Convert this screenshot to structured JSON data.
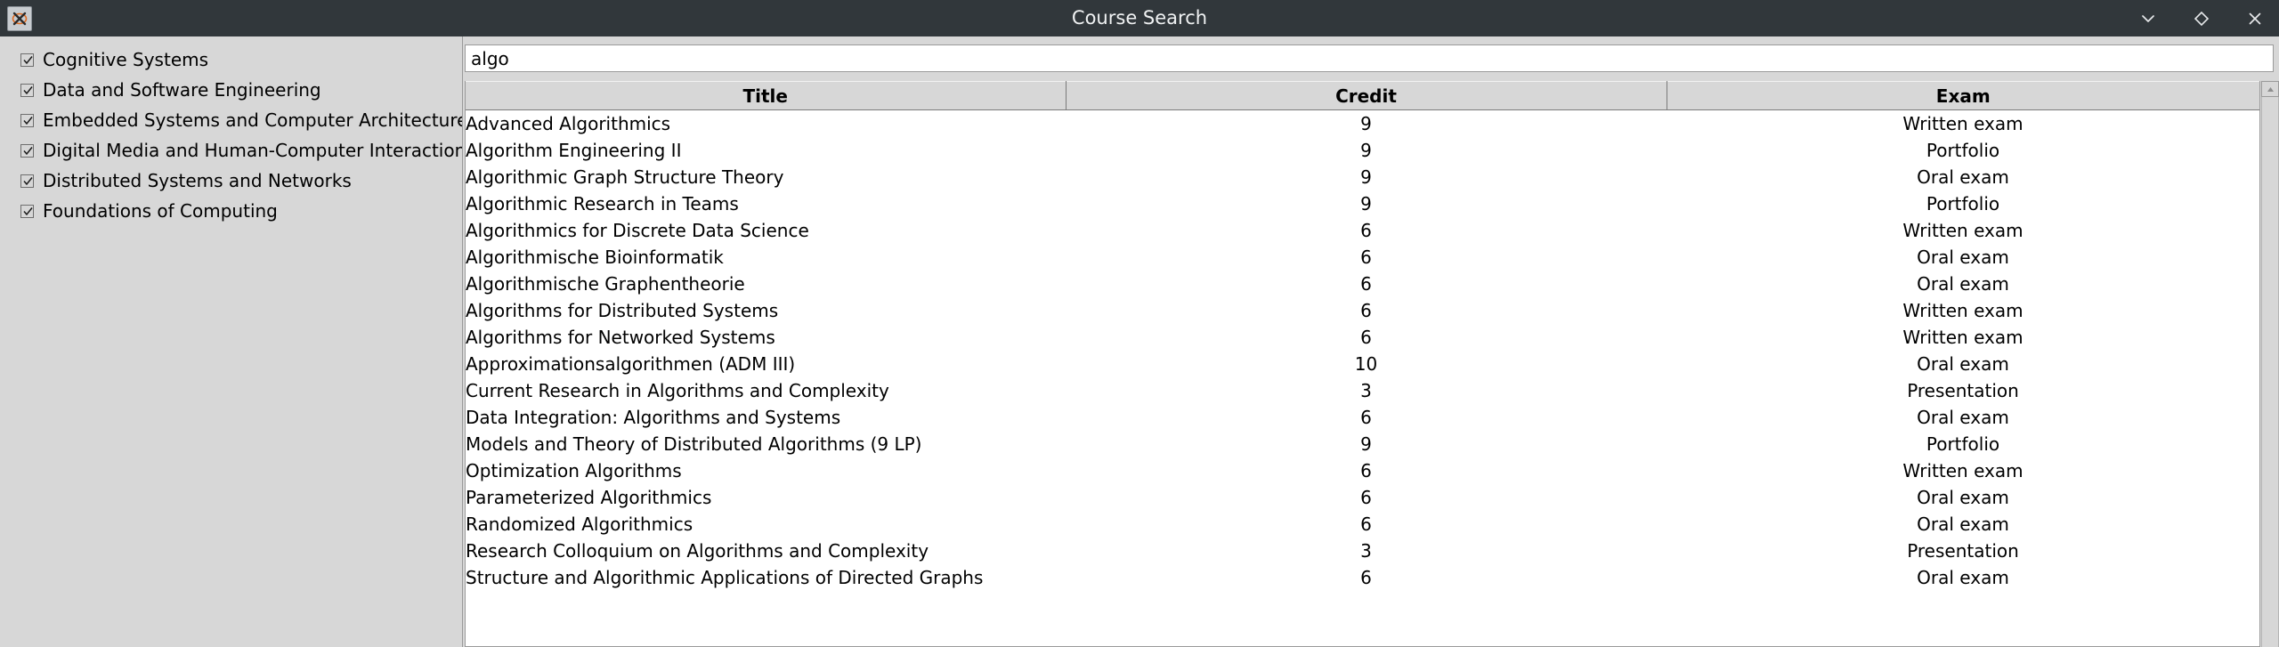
{
  "window": {
    "title": "Course Search",
    "app_icon": "x11-logo-icon",
    "controls": [
      {
        "name": "minimize-button",
        "icon": "chevron-down-icon"
      },
      {
        "name": "maximize-button",
        "icon": "diamond-icon"
      },
      {
        "name": "close-button",
        "icon": "close-icon"
      }
    ]
  },
  "sidebar": {
    "items": [
      {
        "label": "Cognitive Systems",
        "checked": true
      },
      {
        "label": "Data and Software Engineering",
        "checked": true
      },
      {
        "label": "Embedded Systems and Computer Architectures",
        "checked": true
      },
      {
        "label": "Digital Media and Human-Computer Interaction",
        "checked": true
      },
      {
        "label": "Distributed Systems and Networks",
        "checked": true
      },
      {
        "label": "Foundations of Computing",
        "checked": true
      }
    ]
  },
  "search": {
    "value": "algo",
    "placeholder": ""
  },
  "table": {
    "columns": [
      "Title",
      "Credit",
      "Exam"
    ],
    "rows": [
      {
        "title": "Advanced Algorithmics",
        "credit": "9",
        "exam": "Written exam"
      },
      {
        "title": "Algorithm Engineering II",
        "credit": "9",
        "exam": "Portfolio"
      },
      {
        "title": "Algorithmic Graph Structure Theory",
        "credit": "9",
        "exam": "Oral exam"
      },
      {
        "title": "Algorithmic Research in Teams",
        "credit": "9",
        "exam": "Portfolio"
      },
      {
        "title": "Algorithmics for Discrete Data Science",
        "credit": "6",
        "exam": "Written exam"
      },
      {
        "title": "Algorithmische Bioinformatik",
        "credit": "6",
        "exam": "Oral exam"
      },
      {
        "title": "Algorithmische Graphentheorie",
        "credit": "6",
        "exam": "Oral exam"
      },
      {
        "title": "Algorithms for Distributed Systems",
        "credit": "6",
        "exam": "Written exam"
      },
      {
        "title": "Algorithms for Networked Systems",
        "credit": "6",
        "exam": "Written exam"
      },
      {
        "title": "Approximationsalgorithmen (ADM III)",
        "credit": "10",
        "exam": "Oral exam"
      },
      {
        "title": "Current Research in Algorithms and Complexity",
        "credit": "3",
        "exam": "Presentation"
      },
      {
        "title": "Data Integration: Algorithms and Systems",
        "credit": "6",
        "exam": "Oral exam"
      },
      {
        "title": "Models and Theory of Distributed Algorithms (9 LP)",
        "credit": "9",
        "exam": "Portfolio"
      },
      {
        "title": "Optimization Algorithms",
        "credit": "6",
        "exam": "Written exam"
      },
      {
        "title": "Parameterized Algorithmics",
        "credit": "6",
        "exam": "Oral exam"
      },
      {
        "title": "Randomized Algorithmics",
        "credit": "6",
        "exam": "Oral exam"
      },
      {
        "title": "Research Colloquium on Algorithms and Complexity",
        "credit": "3",
        "exam": "Presentation"
      },
      {
        "title": "Structure and Algorithmic Applications of Directed Graphs",
        "credit": "6",
        "exam": "Oral exam"
      }
    ]
  },
  "scrollbar": {
    "up_arrow_icon": "triangle-up-icon"
  },
  "colors": {
    "titlebar_bg": "#31373b",
    "titlebar_text": "#f0f2f3",
    "panel_bg": "#d7d7d7",
    "content_bg": "#ffffff",
    "border": "#9a9a9a",
    "text": "#000000"
  }
}
